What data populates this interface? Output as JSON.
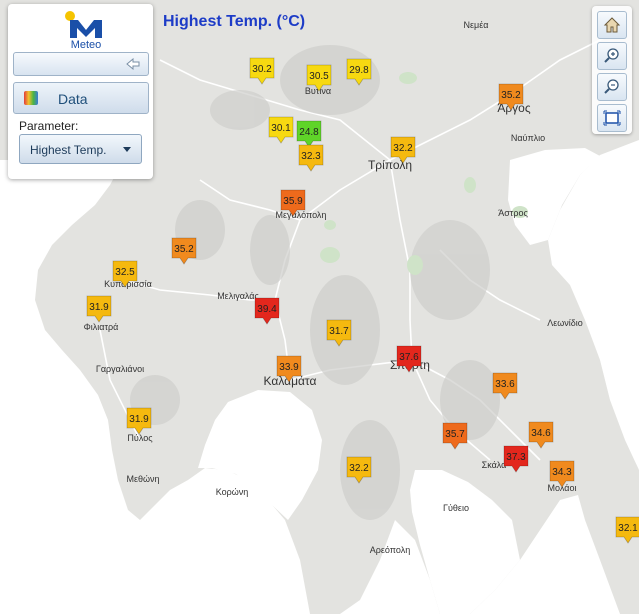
{
  "title": "Highest Temp. (°C)",
  "logo": {
    "text": "Meteo",
    "icon": "meteo-logo-icon"
  },
  "panel": {
    "data_label": "Data",
    "parameter_label": "Parameter:",
    "parameter_value": "Highest Temp."
  },
  "toolbar": {
    "home_icon": "home-icon",
    "zoom_in_icon": "zoom-in-icon",
    "zoom_out_icon": "zoom-out-icon",
    "extent_icon": "full-extent-icon"
  },
  "colors": {
    "yellow": "#f7d911",
    "gold": "#f5b90f",
    "orange": "#f08a1e",
    "deep_orange": "#ee6a1c",
    "red": "#e3271d",
    "green": "#5fd428",
    "water": "#ffffff",
    "land": "#e3e3e0"
  },
  "towns": [
    {
      "name": "Νεμέα"
    },
    {
      "name": "Βυτίνα"
    },
    {
      "name": "Άργος"
    },
    {
      "name": "Ναύπλιο"
    },
    {
      "name": "Τρίπολη"
    },
    {
      "name": "Μεγαλόπολη"
    },
    {
      "name": "Άστρος"
    },
    {
      "name": "Κυπαρισσία"
    },
    {
      "name": "Μελιγαλάς"
    },
    {
      "name": "Φιλιατρά"
    },
    {
      "name": "Λεωνίδιο"
    },
    {
      "name": "Γαργαλιάνοι"
    },
    {
      "name": "Καλαμάτα"
    },
    {
      "name": "Σπάρτη"
    },
    {
      "name": "Πύλος"
    },
    {
      "name": "Σκάλα"
    },
    {
      "name": "Μολάοι"
    },
    {
      "name": "Μεθώνη"
    },
    {
      "name": "Κορώνη"
    },
    {
      "name": "Γύθειο"
    },
    {
      "name": "Αρεόπολη"
    }
  ],
  "markers": [
    {
      "value": "30.2",
      "level": "yellow"
    },
    {
      "value": "30.5",
      "level": "yellow"
    },
    {
      "value": "29.8",
      "level": "yellow"
    },
    {
      "value": "35.2",
      "level": "orange"
    },
    {
      "value": "30.1",
      "level": "yellow"
    },
    {
      "value": "24.8",
      "level": "green"
    },
    {
      "value": "32.3",
      "level": "gold"
    },
    {
      "value": "32.2",
      "level": "gold"
    },
    {
      "value": "35.9",
      "level": "deep_orange"
    },
    {
      "value": "35.2",
      "level": "orange"
    },
    {
      "value": "32.5",
      "level": "gold"
    },
    {
      "value": "31.9",
      "level": "gold"
    },
    {
      "value": "39.4",
      "level": "red"
    },
    {
      "value": "31.7",
      "level": "gold"
    },
    {
      "value": "37.6",
      "level": "red"
    },
    {
      "value": "33.9",
      "level": "orange"
    },
    {
      "value": "33.6",
      "level": "orange"
    },
    {
      "value": "31.9",
      "level": "gold"
    },
    {
      "value": "35.7",
      "level": "deep_orange"
    },
    {
      "value": "34.6",
      "level": "orange"
    },
    {
      "value": "37.3",
      "level": "red"
    },
    {
      "value": "34.3",
      "level": "orange"
    },
    {
      "value": "32.2",
      "level": "gold"
    },
    {
      "value": "32.1",
      "level": "gold"
    }
  ]
}
